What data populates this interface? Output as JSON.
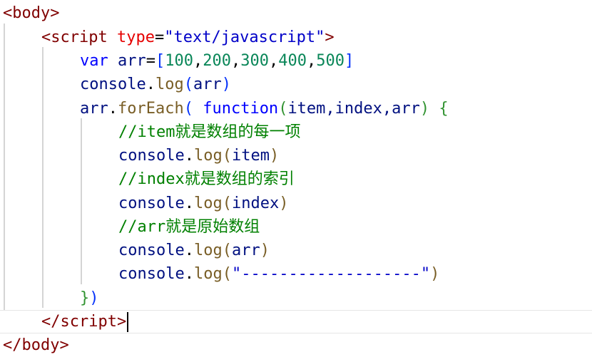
{
  "code": {
    "l1": {
      "open": "<",
      "tag": "body",
      "close": ">"
    },
    "l2": {
      "open": "<",
      "tag": "script",
      "attr": "type",
      "eq": "=",
      "str": "\"text/javascript\"",
      "close": ">"
    },
    "l3": {
      "kw": "var",
      "name": "arr",
      "eq": "=",
      "lb": "[",
      "n1": "100",
      "n2": "200",
      "n3": "300",
      "n4": "400",
      "n5": "500",
      "comma": ",",
      "rb": "]"
    },
    "l4": {
      "obj": "console",
      "dot": ".",
      "fn": "log",
      "lp": "(",
      "arg": "arr",
      "rp": ")"
    },
    "l5": {
      "obj": "arr",
      "dot": ".",
      "fn": "forEach",
      "lp": "(",
      "kw": "function",
      "lp2": "(",
      "args": "item,index,arr",
      "rp2": ")",
      "lb": "{"
    },
    "l6": {
      "text": "//item就是数组的每一项"
    },
    "l7": {
      "obj": "console",
      "dot": ".",
      "fn": "log",
      "lp": "(",
      "arg": "item",
      "rp": ")"
    },
    "l8": {
      "text": "//index就是数组的索引"
    },
    "l9": {
      "obj": "console",
      "dot": ".",
      "fn": "log",
      "lp": "(",
      "arg": "index",
      "rp": ")"
    },
    "l10": {
      "text": "//arr就是原始数组"
    },
    "l11": {
      "obj": "console",
      "dot": ".",
      "fn": "log",
      "lp": "(",
      "arg": "arr",
      "rp": ")"
    },
    "l12": {
      "obj": "console",
      "dot": ".",
      "fn": "log",
      "lp": "(",
      "str": "\"-------------------\"",
      "rp": ")"
    },
    "l13": {
      "rb": "}",
      "rp": ")"
    },
    "l14": {
      "open": "</",
      "tag": "script",
      "close": ">"
    },
    "l15": {
      "open": "</",
      "tag": "body",
      "close": ">"
    }
  }
}
